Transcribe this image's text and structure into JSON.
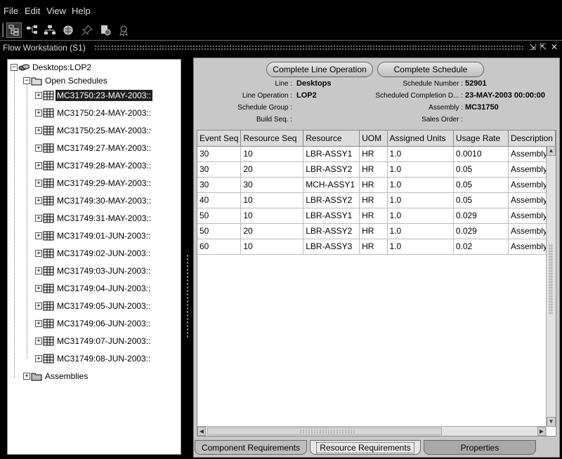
{
  "menu": {
    "items": [
      "File",
      "Edit",
      "View",
      "Help"
    ]
  },
  "toolbar": {
    "buttons": [
      {
        "icon": "workstation-tree-icon",
        "pressed": true
      },
      {
        "icon": "hierarchy-icon"
      },
      {
        "icon": "org-chart-icon"
      },
      {
        "icon": "globe-icon"
      },
      {
        "icon": "pin-icon"
      },
      {
        "icon": "document-gear-icon"
      },
      {
        "icon": "award-icon"
      }
    ]
  },
  "window": {
    "title": "Flow Workstation  (S1)",
    "controls": {
      "minimize": "⇲",
      "restore": "⇱",
      "close": "✕"
    }
  },
  "navigator": {
    "root": "Desktops:LOP2",
    "open_schedules": "Open Schedules",
    "schedules": [
      "MC31750:23-MAY-2003::",
      "MC31750:24-MAY-2003::",
      "MC31750:25-MAY-2003::",
      "MC31749:27-MAY-2003::",
      "MC31749:28-MAY-2003::",
      "MC31749:29-MAY-2003::",
      "MC31749:30-MAY-2003::",
      "MC31749:31-MAY-2003::",
      "MC31749:01-JUN-2003::",
      "MC31749:02-JUN-2003::",
      "MC31749:03-JUN-2003::",
      "MC31749:04-JUN-2003::",
      "MC31749:05-JUN-2003::",
      "MC31749:06-JUN-2003::",
      "MC31749:07-JUN-2003::",
      "MC31749:08-JUN-2003::"
    ],
    "assemblies": "Assemblies"
  },
  "actions": {
    "complete_line_operation": "Complete Line Operation",
    "complete_schedule": "Complete Schedule"
  },
  "details": {
    "line_label": "Line :",
    "line_value": "Desktops",
    "line_operation_label": "Line Operation :",
    "line_operation_value": "LOP2",
    "schedule_group_label": "Schedule Group :",
    "schedule_group_value": "",
    "build_seq_label": "Build Seq. :",
    "build_seq_value": "",
    "schedule_number_label": "Schedule Number :",
    "schedule_number_value": "52901",
    "scheduled_completion_label": "Scheduled Completion D... :",
    "scheduled_completion_value": "23-MAY-2003 00:00:00",
    "assembly_label": "Assembly :",
    "assembly_value": "MC31750",
    "sales_order_label": "Sales Order :",
    "sales_order_value": ""
  },
  "table": {
    "columns": [
      "Event Seq",
      "Resource Seq",
      "Resource",
      "UOM",
      "Assigned Units",
      "Usage Rate",
      "Description"
    ],
    "rows": [
      [
        "30",
        "10",
        "LBR-ASSY1",
        "HR",
        "1.0",
        "0.0010",
        "Assembly"
      ],
      [
        "30",
        "20",
        "LBR-ASSY2",
        "HR",
        "1.0",
        "0.05",
        "Assembly"
      ],
      [
        "30",
        "30",
        "MCH-ASSY1",
        "HR",
        "1.0",
        "0.05",
        "Assembly"
      ],
      [
        "40",
        "10",
        "LBR-ASSY2",
        "HR",
        "1.0",
        "0.05",
        "Assembly"
      ],
      [
        "50",
        "10",
        "LBR-ASSY1",
        "HR",
        "1.0",
        "0.029",
        "Assembly"
      ],
      [
        "50",
        "20",
        "LBR-ASSY2",
        "HR",
        "1.0",
        "0.029",
        "Assembly"
      ],
      [
        "60",
        "10",
        "LBR-ASSY3",
        "HR",
        "1.0",
        "0.02",
        "Assembly"
      ]
    ]
  },
  "tabs": [
    {
      "label": "Component Requirements",
      "active": false
    },
    {
      "label": "Resource Requirements",
      "active": true
    },
    {
      "label": "Properties",
      "active": false
    }
  ]
}
